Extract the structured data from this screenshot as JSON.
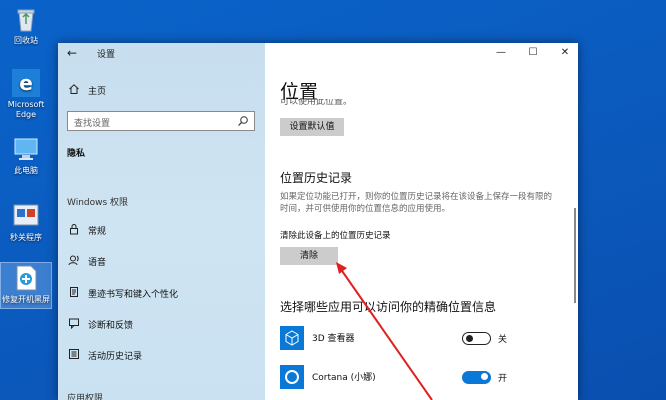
{
  "desktop": {
    "icons": [
      {
        "label": "回收站",
        "icon": "recycle-bin-icon"
      },
      {
        "label": "Microsoft Edge",
        "icon": "edge-icon"
      },
      {
        "label": "此电脑",
        "icon": "this-pc-icon"
      },
      {
        "label": "秒关程序",
        "icon": "program-icon"
      },
      {
        "label": "修复开机黑屏",
        "icon": "repair-tool-icon"
      }
    ]
  },
  "window": {
    "title": "设置",
    "back_icon": "←",
    "controls": {
      "minimize": "—",
      "maximize": "☐",
      "close": "✕"
    }
  },
  "nav": {
    "home": "主页",
    "search_placeholder": "查找设置",
    "privacy": "隐私",
    "windows_permissions": "Windows 权限",
    "items": [
      {
        "label": "常规",
        "icon": "lock-icon"
      },
      {
        "label": "语音",
        "icon": "speech-icon"
      },
      {
        "label": "墨迹书写和键入个性化",
        "icon": "inking-icon"
      },
      {
        "label": "诊断和反馈",
        "icon": "feedback-icon"
      },
      {
        "label": "活动历史记录",
        "icon": "history-icon"
      }
    ],
    "app_permissions": "应用权限"
  },
  "content": {
    "page_title": "位置",
    "cut_text": "可以使用此位置。",
    "set_default_button": "设置默认值",
    "history_heading": "位置历史记录",
    "history_desc": "如果定位功能已打开，则你的位置历史记录将在该设备上保存一段有限的时间，并可供使用你的位置信息的应用使用。",
    "clear_label": "清除此设备上的位置历史记录",
    "clear_button": "清除",
    "apps_heading": "选择哪些应用可以访问你的精确位置信息",
    "apps": [
      {
        "name": "3D 查看器",
        "state": "关",
        "on": false
      },
      {
        "name": "Cortana (小娜)",
        "state": "开",
        "on": true
      }
    ]
  },
  "colors": {
    "accent": "#0a78d7",
    "annotation_arrow": "#e02020"
  }
}
